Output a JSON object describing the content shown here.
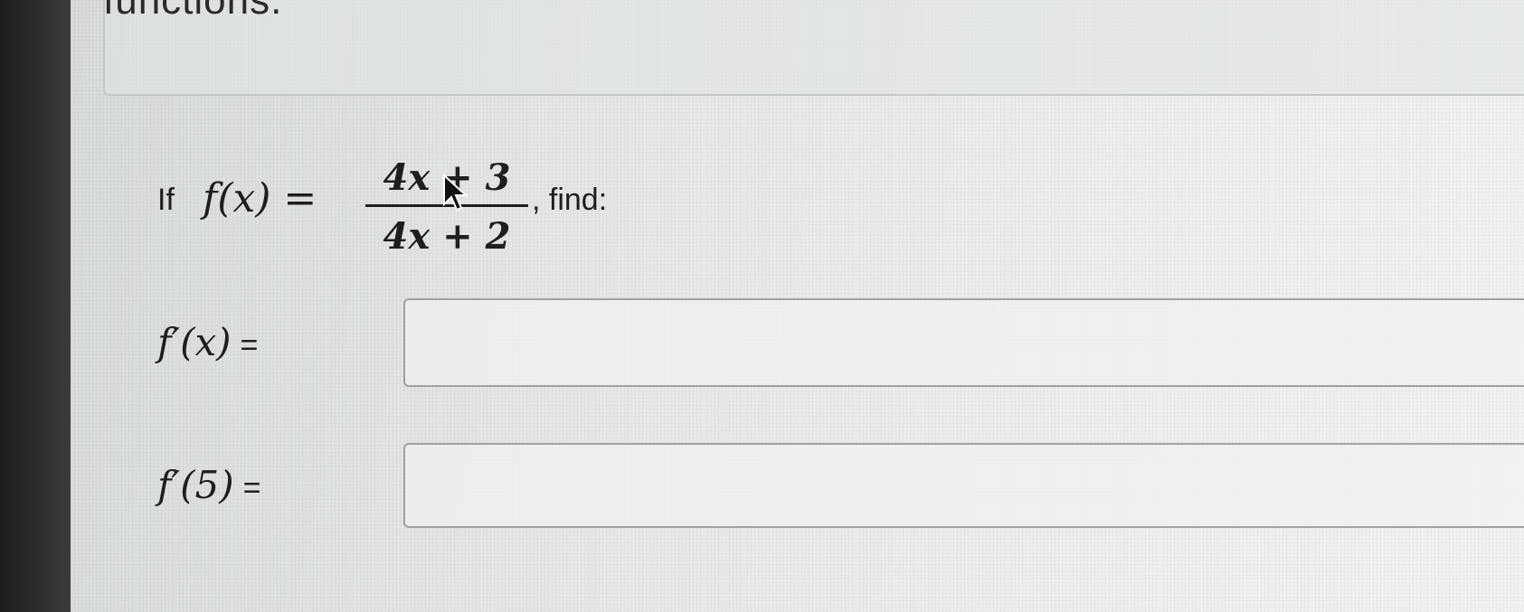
{
  "top_panel": {
    "title": "functions."
  },
  "problem": {
    "prefix": "If",
    "function_lhs": "f(x) =",
    "numerator": "4x + 3",
    "denominator": "4x + 2",
    "suffix": ", find:"
  },
  "answers": [
    {
      "label": "f′(x)",
      "equals": "=",
      "value": ""
    },
    {
      "label": "f′(5)",
      "equals": "=",
      "value": ""
    }
  ],
  "icons": {
    "cursor": "mouse-pointer-icon"
  }
}
